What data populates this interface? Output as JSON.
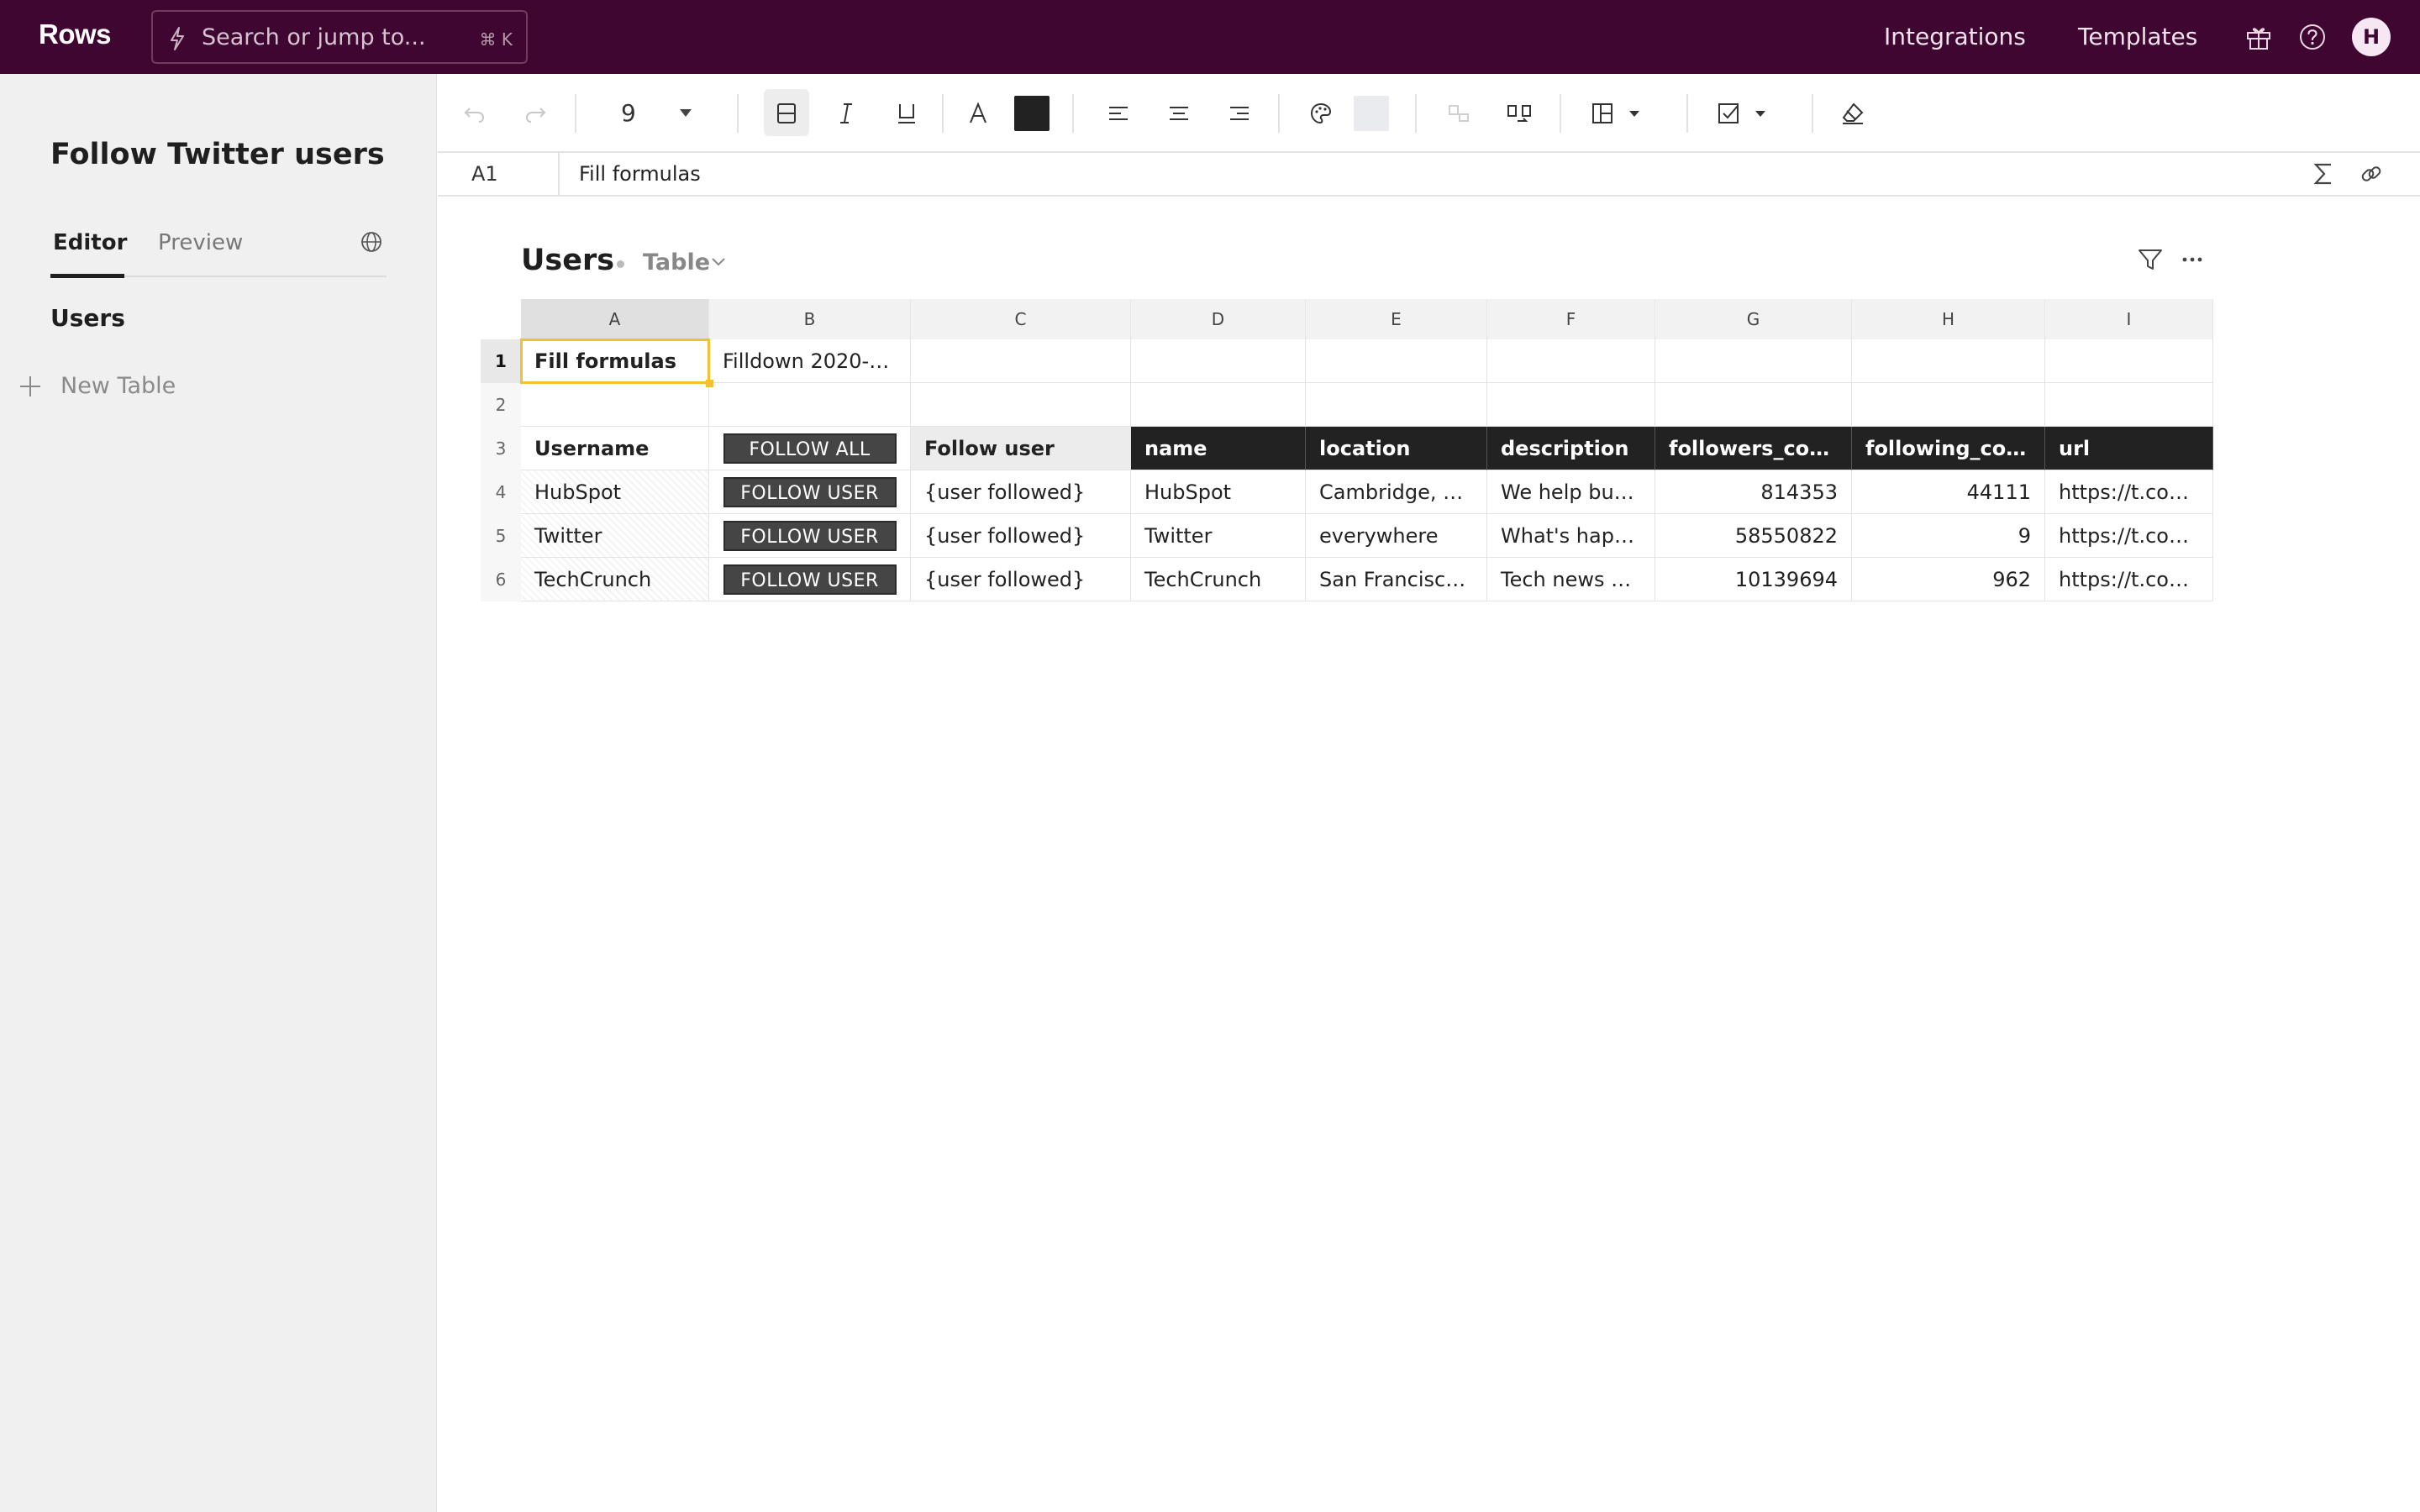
{
  "app": {
    "logo": "Rows"
  },
  "search": {
    "placeholder": "Search or jump to...",
    "shortcut": "⌘ K"
  },
  "topnav": {
    "integrations": "Integrations",
    "templates": "Templates",
    "avatar_initial": "H"
  },
  "sidebar": {
    "doc_title": "Follow Twitter users",
    "tabs": [
      {
        "label": "Editor",
        "active": true
      },
      {
        "label": "Preview",
        "active": false
      }
    ],
    "tables": [
      "Users"
    ],
    "new_table_label": "New Table"
  },
  "toolbar": {
    "font_size": "9",
    "text_color": "#222222",
    "fill_color": "#e9ebee"
  },
  "formula_bar": {
    "cell_ref": "A1",
    "value": "Fill formulas"
  },
  "table": {
    "title": "Users",
    "kind": "Table",
    "columns": [
      "A",
      "B",
      "C",
      "D",
      "E",
      "F",
      "G",
      "H",
      "I"
    ],
    "row_numbers": [
      "1",
      "2",
      "3",
      "4",
      "5",
      "6"
    ],
    "rows": [
      [
        "Fill formulas",
        "Filldown 2020-…",
        "",
        "",
        "",
        "",
        "",
        "",
        ""
      ],
      [
        "",
        "",
        "",
        "",
        "",
        "",
        "",
        "",
        ""
      ],
      [
        "Username",
        "FOLLOW ALL",
        "Follow user",
        "name",
        "location",
        "description",
        "followers_count",
        "following_count",
        "url"
      ],
      [
        "HubSpot",
        "FOLLOW USER",
        "{user followed}",
        "HubSpot",
        "Cambridge, MA",
        "We help busi…",
        "814353",
        "44111",
        "https://t.co…"
      ],
      [
        "Twitter",
        "FOLLOW USER",
        "{user followed}",
        "Twitter",
        "everywhere",
        "What's happ…",
        "58550822",
        "9",
        "https://t.co…"
      ],
      [
        "TechCrunch",
        "FOLLOW USER",
        "{user followed}",
        "TechCrunch",
        "San Francisco…",
        "Tech news w…",
        "10139694",
        "962",
        "https://t.co…"
      ]
    ]
  },
  "colors": {
    "topbar": "#3f0631",
    "accent_selection": "#f3c033",
    "header_dark": "#222222",
    "button": "#454545"
  }
}
